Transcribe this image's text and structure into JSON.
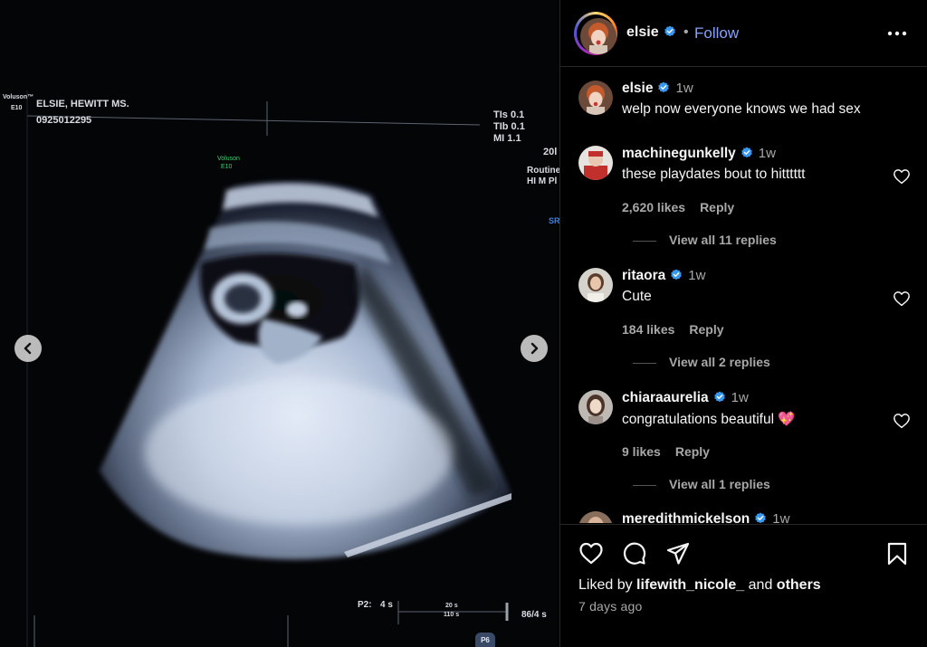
{
  "post": {
    "media": {
      "patient_name": "ELSIE, HEWITT  MS.",
      "patient_id": "0925012295",
      "machine_brand": "Voluson™",
      "machine_model": "E10",
      "probe_label": "Voluson",
      "probe_model": "E10",
      "tis": "TIs  0.1",
      "tib": "TIb  0.1",
      "mi": "MI   1.1",
      "depth_frag": "20l",
      "preset_line1": "Routine",
      "preset_line2": "HI M Pl",
      "sr_frag": "SR",
      "p2_label": "P2:",
      "p2_value": "4 s",
      "timeline_a": "20 s",
      "timeline_b": "110 s",
      "counter": "86/4 s",
      "page_badge": "P6"
    },
    "prev_icon": "chevron-left-icon",
    "next_icon": "chevron-right-icon"
  },
  "header": {
    "username": "elsie",
    "separator": "•",
    "follow_label": "Follow",
    "more_icon": "more-horizontal-icon"
  },
  "caption": {
    "username": "elsie",
    "time": "1w",
    "text": "welp now everyone knows we had sex"
  },
  "comments": [
    {
      "username": "machinegunkelly",
      "time": "1w",
      "text": "these playdates bout to hitttttt",
      "likes": "2,620 likes",
      "reply": "Reply",
      "view_replies": "View all 11 replies"
    },
    {
      "username": "ritaora",
      "time": "1w",
      "text": "Cute",
      "likes": "184 likes",
      "reply": "Reply",
      "view_replies": "View all 2 replies"
    },
    {
      "username": "chiaraaurelia",
      "time": "1w",
      "text": "congratulations beautiful 💖",
      "likes": "9 likes",
      "reply": "Reply",
      "view_replies": "View all 1 replies"
    },
    {
      "username": "meredithmickelson",
      "time": "1w"
    }
  ],
  "actions": {
    "like_icon": "heart-icon",
    "comment_icon": "comment-icon",
    "share_icon": "share-icon",
    "save_icon": "bookmark-icon",
    "liked_by_prefix": "Liked by",
    "liked_by_user": "lifewith_nicole_",
    "liked_by_and": "and",
    "liked_by_others": "others",
    "date": "7 days ago"
  },
  "colors": {
    "follow": "#85a1ff",
    "verified": "#3897f0",
    "muted_text": "#a8a8a8",
    "background": "#000000"
  }
}
